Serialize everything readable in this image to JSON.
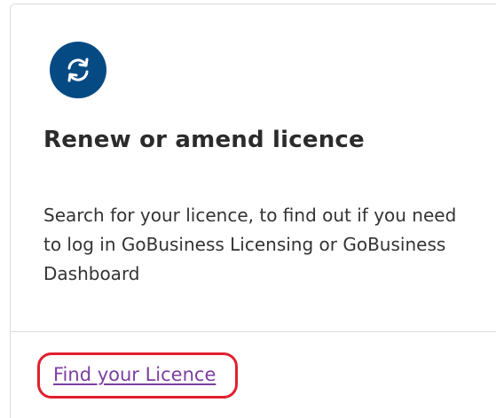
{
  "card": {
    "icon": "refresh-icon",
    "title": "Renew or amend licence",
    "description": "Search for your licence, to find out if you need to log in GoBusiness Licensing or GoBusiness Dashboard",
    "link_label": "Find your Licence"
  },
  "colors": {
    "icon_background": "#064a84",
    "link": "#7b3fa0",
    "highlight": "#e0202e",
    "border": "#dcdcdc"
  }
}
